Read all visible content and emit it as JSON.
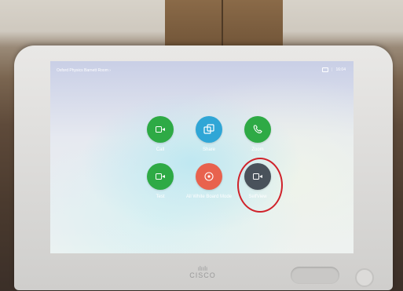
{
  "header": {
    "room_name": "Oxford Physics Barnett Room",
    "chevron": "›",
    "time": "16:04"
  },
  "tiles": [
    {
      "label": "Call",
      "color": "#2eaa45",
      "icon": "video-camera-icon"
    },
    {
      "label": "Share",
      "color": "#2fa6d6",
      "icon": "share-screens-icon"
    },
    {
      "label": "Zoom",
      "color": "#2eaa45",
      "icon": "phone-icon"
    },
    {
      "label": "Test",
      "color": "#2eaa45",
      "icon": "video-camera-icon"
    },
    {
      "label": "All White Board Mode",
      "color": "#e8624e",
      "icon": "record-icon"
    },
    {
      "label": "SelfView",
      "color": "#49525b",
      "icon": "video-camera-icon"
    }
  ],
  "device": {
    "brand": "CISCO"
  }
}
